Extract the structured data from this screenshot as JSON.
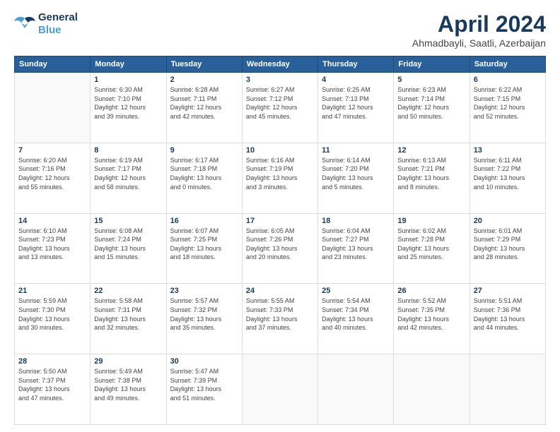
{
  "logo": {
    "line1": "General",
    "line2": "Blue"
  },
  "title": "April 2024",
  "subtitle": "Ahmadbayli, Saatli, Azerbaijan",
  "weekdays": [
    "Sunday",
    "Monday",
    "Tuesday",
    "Wednesday",
    "Thursday",
    "Friday",
    "Saturday"
  ],
  "weeks": [
    [
      {
        "day": "",
        "info": ""
      },
      {
        "day": "1",
        "info": "Sunrise: 6:30 AM\nSunset: 7:10 PM\nDaylight: 12 hours\nand 39 minutes."
      },
      {
        "day": "2",
        "info": "Sunrise: 6:28 AM\nSunset: 7:11 PM\nDaylight: 12 hours\nand 42 minutes."
      },
      {
        "day": "3",
        "info": "Sunrise: 6:27 AM\nSunset: 7:12 PM\nDaylight: 12 hours\nand 45 minutes."
      },
      {
        "day": "4",
        "info": "Sunrise: 6:25 AM\nSunset: 7:13 PM\nDaylight: 12 hours\nand 47 minutes."
      },
      {
        "day": "5",
        "info": "Sunrise: 6:23 AM\nSunset: 7:14 PM\nDaylight: 12 hours\nand 50 minutes."
      },
      {
        "day": "6",
        "info": "Sunrise: 6:22 AM\nSunset: 7:15 PM\nDaylight: 12 hours\nand 52 minutes."
      }
    ],
    [
      {
        "day": "7",
        "info": "Sunrise: 6:20 AM\nSunset: 7:16 PM\nDaylight: 12 hours\nand 55 minutes."
      },
      {
        "day": "8",
        "info": "Sunrise: 6:19 AM\nSunset: 7:17 PM\nDaylight: 12 hours\nand 58 minutes."
      },
      {
        "day": "9",
        "info": "Sunrise: 6:17 AM\nSunset: 7:18 PM\nDaylight: 13 hours\nand 0 minutes."
      },
      {
        "day": "10",
        "info": "Sunrise: 6:16 AM\nSunset: 7:19 PM\nDaylight: 13 hours\nand 3 minutes."
      },
      {
        "day": "11",
        "info": "Sunrise: 6:14 AM\nSunset: 7:20 PM\nDaylight: 13 hours\nand 5 minutes."
      },
      {
        "day": "12",
        "info": "Sunrise: 6:13 AM\nSunset: 7:21 PM\nDaylight: 13 hours\nand 8 minutes."
      },
      {
        "day": "13",
        "info": "Sunrise: 6:11 AM\nSunset: 7:22 PM\nDaylight: 13 hours\nand 10 minutes."
      }
    ],
    [
      {
        "day": "14",
        "info": "Sunrise: 6:10 AM\nSunset: 7:23 PM\nDaylight: 13 hours\nand 13 minutes."
      },
      {
        "day": "15",
        "info": "Sunrise: 6:08 AM\nSunset: 7:24 PM\nDaylight: 13 hours\nand 15 minutes."
      },
      {
        "day": "16",
        "info": "Sunrise: 6:07 AM\nSunset: 7:25 PM\nDaylight: 13 hours\nand 18 minutes."
      },
      {
        "day": "17",
        "info": "Sunrise: 6:05 AM\nSunset: 7:26 PM\nDaylight: 13 hours\nand 20 minutes."
      },
      {
        "day": "18",
        "info": "Sunrise: 6:04 AM\nSunset: 7:27 PM\nDaylight: 13 hours\nand 23 minutes."
      },
      {
        "day": "19",
        "info": "Sunrise: 6:02 AM\nSunset: 7:28 PM\nDaylight: 13 hours\nand 25 minutes."
      },
      {
        "day": "20",
        "info": "Sunrise: 6:01 AM\nSunset: 7:29 PM\nDaylight: 13 hours\nand 28 minutes."
      }
    ],
    [
      {
        "day": "21",
        "info": "Sunrise: 5:59 AM\nSunset: 7:30 PM\nDaylight: 13 hours\nand 30 minutes."
      },
      {
        "day": "22",
        "info": "Sunrise: 5:58 AM\nSunset: 7:31 PM\nDaylight: 13 hours\nand 32 minutes."
      },
      {
        "day": "23",
        "info": "Sunrise: 5:57 AM\nSunset: 7:32 PM\nDaylight: 13 hours\nand 35 minutes."
      },
      {
        "day": "24",
        "info": "Sunrise: 5:55 AM\nSunset: 7:33 PM\nDaylight: 13 hours\nand 37 minutes."
      },
      {
        "day": "25",
        "info": "Sunrise: 5:54 AM\nSunset: 7:34 PM\nDaylight: 13 hours\nand 40 minutes."
      },
      {
        "day": "26",
        "info": "Sunrise: 5:52 AM\nSunset: 7:35 PM\nDaylight: 13 hours\nand 42 minutes."
      },
      {
        "day": "27",
        "info": "Sunrise: 5:51 AM\nSunset: 7:36 PM\nDaylight: 13 hours\nand 44 minutes."
      }
    ],
    [
      {
        "day": "28",
        "info": "Sunrise: 5:50 AM\nSunset: 7:37 PM\nDaylight: 13 hours\nand 47 minutes."
      },
      {
        "day": "29",
        "info": "Sunrise: 5:49 AM\nSunset: 7:38 PM\nDaylight: 13 hours\nand 49 minutes."
      },
      {
        "day": "30",
        "info": "Sunrise: 5:47 AM\nSunset: 7:39 PM\nDaylight: 13 hours\nand 51 minutes."
      },
      {
        "day": "",
        "info": ""
      },
      {
        "day": "",
        "info": ""
      },
      {
        "day": "",
        "info": ""
      },
      {
        "day": "",
        "info": ""
      }
    ]
  ]
}
